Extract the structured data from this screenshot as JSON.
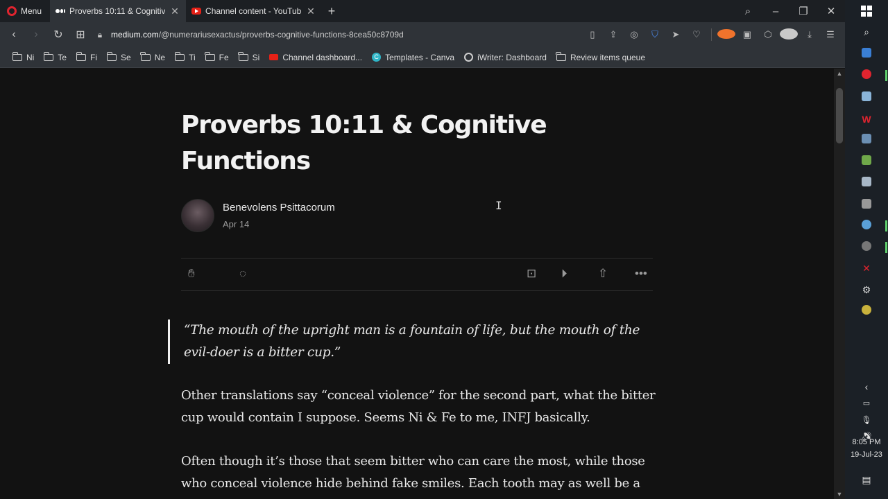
{
  "browser": {
    "menu_label": "Menu",
    "tabs": [
      {
        "title": "Proverbs 10:11 & Cognitiv",
        "favicon": "medium-icon",
        "active": true
      },
      {
        "title": "Channel content - YouTube",
        "favicon": "youtube-icon",
        "active": false
      }
    ],
    "new_tab_label": "+",
    "address": {
      "host": "medium.com",
      "path": "/@numerariusexactus/proverbs-cognitive-functions-8cea50c8709d"
    },
    "bookmarks": [
      {
        "label": "Ni",
        "icon": "folder-icon"
      },
      {
        "label": "Te",
        "icon": "folder-icon"
      },
      {
        "label": "Fi",
        "icon": "folder-icon"
      },
      {
        "label": "Se",
        "icon": "folder-icon"
      },
      {
        "label": "Ne",
        "icon": "folder-icon"
      },
      {
        "label": "Ti",
        "icon": "folder-icon"
      },
      {
        "label": "Fe",
        "icon": "folder-icon"
      },
      {
        "label": "Si",
        "icon": "folder-icon"
      },
      {
        "label": "Channel dashboard...",
        "icon": "youtube-icon"
      },
      {
        "label": "Templates - Canva",
        "icon": "canva-icon"
      },
      {
        "label": "iWriter: Dashboard",
        "icon": "iwriter-icon"
      },
      {
        "label": "Review items queue",
        "icon": "folder-icon"
      }
    ]
  },
  "article": {
    "title": "Proverbs 10:11 & Cognitive Functions",
    "author": "Benevolens Psittacorum",
    "date": "Apr 14",
    "quote": "“The mouth of the upright man is a fountain of life, but the mouth of the evil-doer is a bitter cup.”",
    "paragraphs": [
      "Other translations say “conceal violence” for the second part, what the bitter cup would contain I suppose. Seems Ni & Fe to me, INFJ basically.",
      "Often though it’s those that seem bitter who can care the most, while those who conceal violence hide behind fake smiles. Each tooth may as well be a"
    ]
  },
  "taskbar": {
    "time": "8:05 PM",
    "date": "19-Jul-23"
  }
}
